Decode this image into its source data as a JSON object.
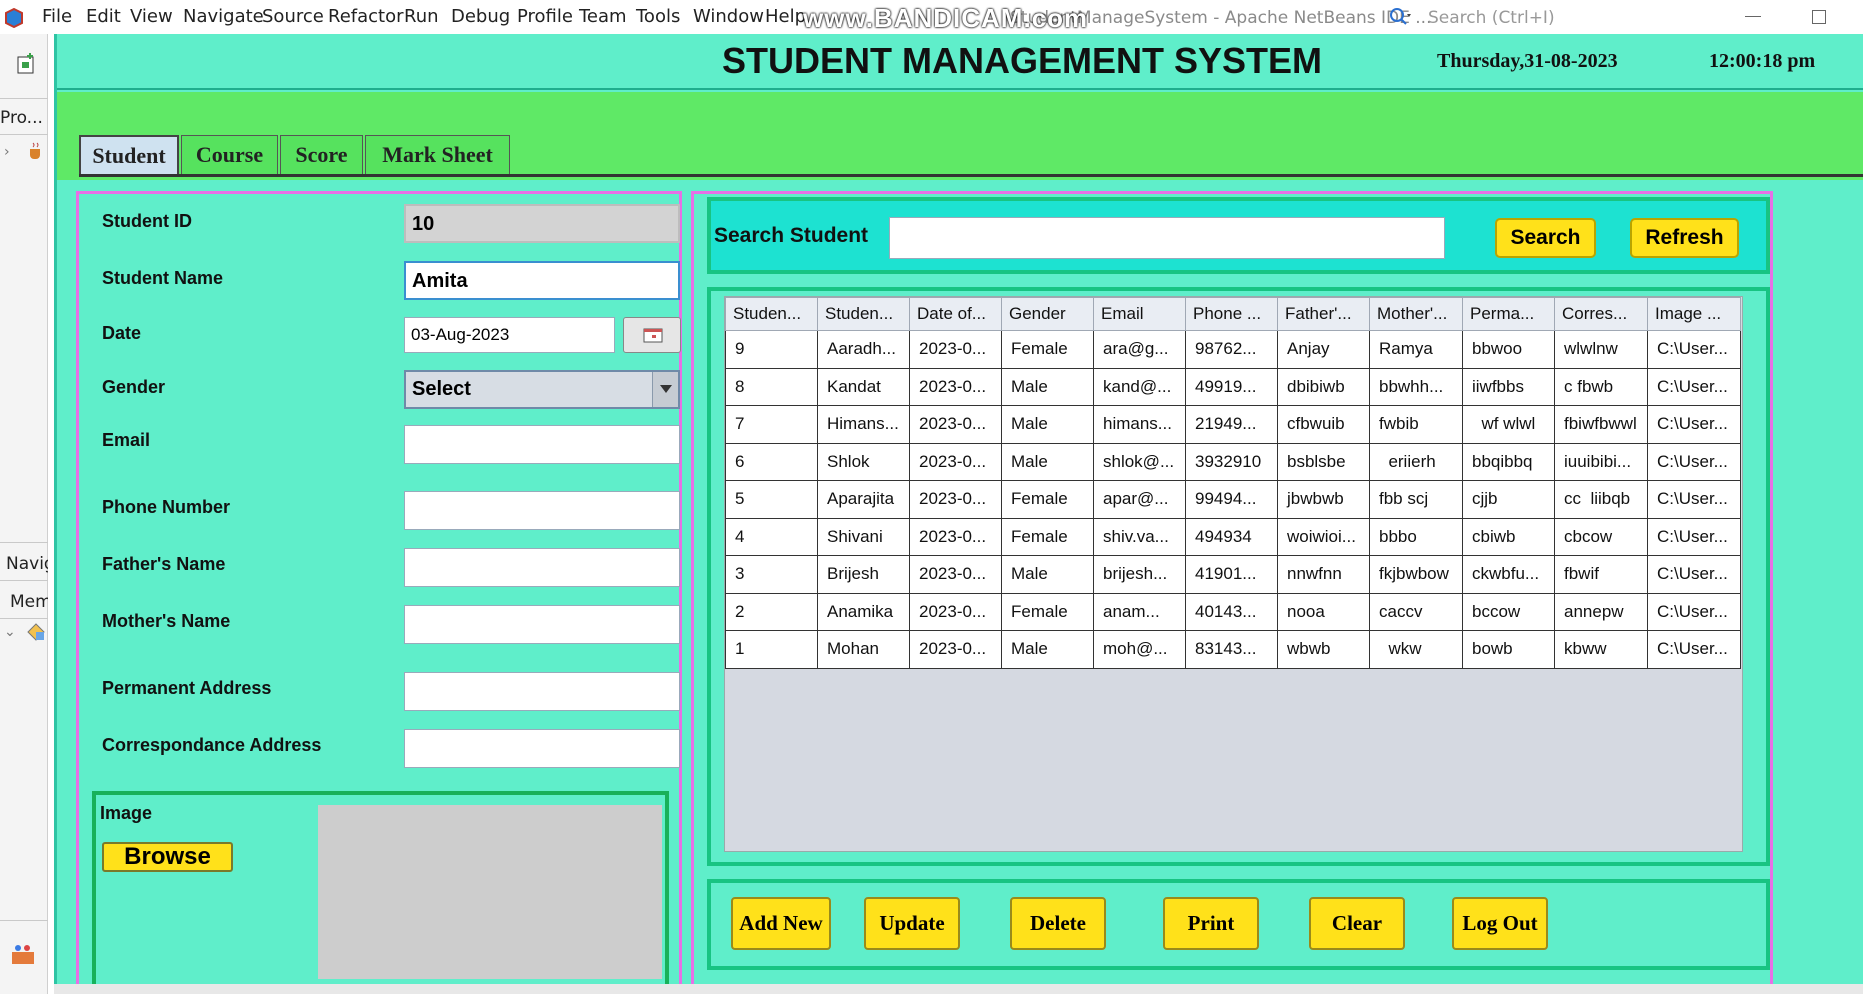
{
  "ide": {
    "menu": [
      "File",
      "Edit",
      "View",
      "Navigate",
      "Source",
      "Refactor",
      "Run",
      "Debug",
      "Profile",
      "Team",
      "Tools",
      "Window",
      "Help"
    ],
    "title": "StudentManageSystem - Apache NetBeans IDE ...",
    "watermark": "www.BANDICAM.com",
    "search_placeholder": "Search (Ctrl+I)",
    "side_projects": "Pro...",
    "side_navigator": "Navig",
    "side_members": "Mem"
  },
  "app": {
    "title": "STUDENT MANAGEMENT SYSTEM",
    "date": "Thursday,31-08-2023",
    "time": "12:00:18 pm",
    "tabs": [
      "Student",
      "Course",
      "Score",
      "Mark Sheet"
    ],
    "active_tab": "Student"
  },
  "form": {
    "student_id_label": "Student ID",
    "student_id_value": "10",
    "student_name_label": "Student Name",
    "student_name_value": "Amita",
    "date_label": "Date",
    "date_value": "03-Aug-2023",
    "gender_label": "Gender",
    "gender_value": "Select",
    "email_label": "Email",
    "email_value": "",
    "phone_label": "Phone Number",
    "phone_value": "",
    "father_label": "Father's Name",
    "father_value": "",
    "mother_label": "Mother's Name",
    "mother_value": "",
    "perm_label": "Permanent Address",
    "perm_value": "",
    "corr_label": "Correspondance Address",
    "corr_value": "",
    "image_label": "Image",
    "browse_label": "Browse"
  },
  "search": {
    "label": "Search Student",
    "value": "",
    "search_button": "Search",
    "refresh_button": "Refresh"
  },
  "table": {
    "columns": [
      "Studen...",
      "Studen...",
      "Date of...",
      "Gender",
      "Email",
      "Phone ...",
      "Father'...",
      "Mother'...",
      "Perma...",
      "Corres...",
      "Image ..."
    ],
    "rows": [
      [
        "9",
        "Aaradh...",
        "2023-0...",
        "Female",
        "ara@g...",
        "98762...",
        "Anjay",
        "Ramya",
        "bbwoo",
        "wlwlnw",
        "C:\\User..."
      ],
      [
        "8",
        "Kandat",
        "2023-0...",
        "Male",
        "kand@...",
        "49919...",
        "dbibiwb",
        "bbwhh...",
        "iiwfbbs",
        "c fbwb",
        "C:\\User..."
      ],
      [
        "7",
        "Himans...",
        "2023-0...",
        "Male",
        "himans...",
        "21949...",
        "cfbwuib",
        "fwbib",
        "  wf wlwl",
        "fbiwfbwwl",
        "C:\\User..."
      ],
      [
        "6",
        "Shlok",
        "2023-0...",
        "Male",
        "shlok@...",
        "3932910",
        "bsblsbe",
        "  eriierh",
        "bbqibbq",
        "iuuibibi...",
        "C:\\User..."
      ],
      [
        "5",
        "Aparajita",
        "2023-0...",
        "Female",
        "apar@...",
        "99494...",
        "jbwbwb",
        "fbb scj",
        "cjjb",
        "cc  liibqb",
        "C:\\User..."
      ],
      [
        "4",
        "Shivani",
        "2023-0...",
        "Female",
        "shiv.va...",
        "494934",
        "woiwioi...",
        "bbbo",
        "cbiwb",
        "cbcow",
        "C:\\User..."
      ],
      [
        "3",
        "Brijesh",
        "2023-0...",
        "Male",
        "brijesh...",
        "41901...",
        "nnwfnn",
        "fkjbwbow",
        "ckwbfu...",
        "fbwif",
        "C:\\User..."
      ],
      [
        "2",
        "Anamika",
        "2023-0...",
        "Female",
        "anam...",
        "40143...",
        "nooa",
        "caccv",
        "bccow",
        "annepw",
        "C:\\User..."
      ],
      [
        "1",
        "Mohan",
        "2023-0...",
        "Male",
        "moh@...",
        "83143...",
        "wbwb",
        "  wkw",
        "bowb",
        "kbww",
        "C:\\User..."
      ]
    ]
  },
  "actions": {
    "add_new": "Add New",
    "update": "Update",
    "delete": "Delete",
    "print": "Print",
    "clear": "Clear",
    "log_out": "Log Out"
  },
  "colors": {
    "panel_bg": "#5feeca",
    "tab_area": "#5fe966",
    "panel_border": "#e670e6",
    "section_border": "#18c482",
    "button_yellow": "#ffe11a"
  }
}
